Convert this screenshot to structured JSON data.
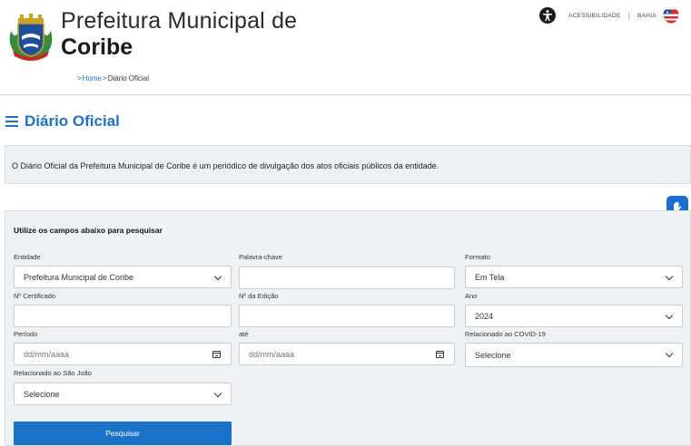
{
  "header": {
    "title_line1": "Prefeitura Municipal de",
    "title_line2": "Coribe",
    "breadcrumb": {
      "home": "Home",
      "current": "Diário Oficial"
    },
    "accessibility_label": "ACESSIBILIDADE",
    "state_label": "BAHIA"
  },
  "page": {
    "heading": "Diário Oficial",
    "description": "O Diário Oficial da Prefeitura Municipal de Coribe é um periódico de divulgação dos atos oficiais públicos da entidade."
  },
  "search": {
    "title": "Utilize os campos abaixo para pesquisar",
    "fields": {
      "entidade": {
        "label": "Entidade",
        "value": "Prefeitura Municipal de Coribe"
      },
      "palavra_chave": {
        "label": "Palavra-chave",
        "value": ""
      },
      "formato": {
        "label": "Formato",
        "value": "Em Tela"
      },
      "certificado": {
        "label": "Nº Certificado",
        "value": ""
      },
      "edicao": {
        "label": "Nº da Edição",
        "value": ""
      },
      "ano": {
        "label": "Ano",
        "value": "2024"
      },
      "periodo": {
        "label": "Período",
        "placeholder": "dd/mm/aaaa"
      },
      "ate": {
        "label": "até",
        "placeholder": "dd/mm/aaaa"
      },
      "covid": {
        "label": "Relacionado ao COVID-19",
        "value": "Selecione"
      },
      "sao_joao": {
        "label": "Relacionado ao São João",
        "value": "Selecione"
      }
    },
    "submit_label": "Pesquisar"
  },
  "colors": {
    "accent": "#1a73c9",
    "panel_bg": "#eef2f5",
    "vlibras": "#1b6fd1"
  },
  "icons": {
    "crest": "municipal-crest-icon",
    "accessibility": "accessibility-person-icon",
    "flag": "bahia-flag-icon",
    "menu": "hamburger-menu-icon",
    "hand": "sign-language-hand-icon"
  }
}
